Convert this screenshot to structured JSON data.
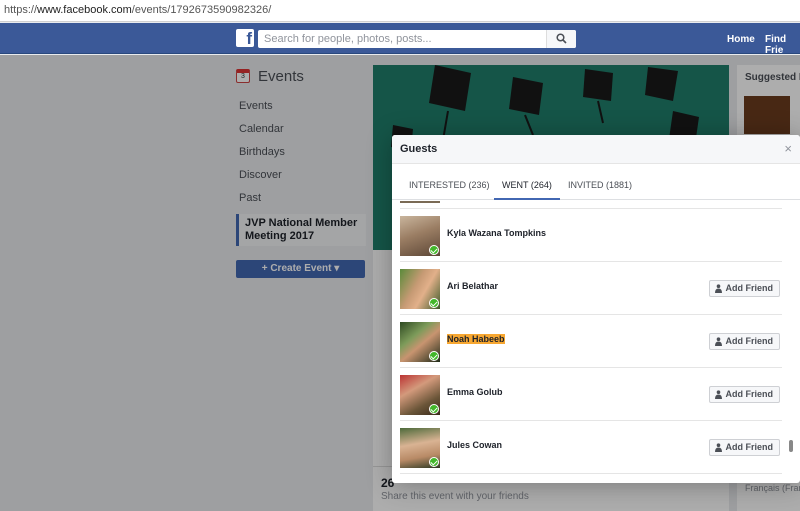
{
  "browser": {
    "url_prefix": "https://",
    "url_host": "www.facebook.com",
    "url_path": "/events/1792673590982326/"
  },
  "topbar": {
    "logo": "f",
    "search_placeholder": "Search for people, photos, posts...",
    "nav": [
      "Home",
      "Find Frie"
    ]
  },
  "leftnav": {
    "title": "Events",
    "calendar_day": "3",
    "items": [
      "Events",
      "Calendar",
      "Birthdays",
      "Discover",
      "Past"
    ],
    "active_event": "JVP National Member Meeting 2017",
    "create_label": "+ Create Event ▾"
  },
  "share": {
    "count": "26",
    "text": "Share this event with your friends"
  },
  "rightcol": {
    "suggested": "Suggested Ev",
    "lang": "Français (Fran"
  },
  "modal": {
    "title": "Guests",
    "close": "×",
    "tabs": [
      {
        "label": "INTERESTED (236)"
      },
      {
        "label": "WENT (264)"
      },
      {
        "label": "INVITED (1881)"
      }
    ],
    "guests": [
      {
        "name": "Kyla Wazana Tompkins",
        "has_add": false,
        "highlight": false
      },
      {
        "name": "Ari Belathar",
        "has_add": true,
        "highlight": false
      },
      {
        "name": "Noah Habeeb",
        "has_add": true,
        "highlight": true
      },
      {
        "name": "Emma Golub",
        "has_add": true,
        "highlight": false
      },
      {
        "name": "Jules Cowan",
        "has_add": true,
        "highlight": false
      }
    ],
    "add_friend_label": "Add Friend"
  },
  "colors": {
    "brand": "#3b5998",
    "accent": "#4267b2",
    "highlight": "#f7a731",
    "went_check": "#42b72a"
  }
}
